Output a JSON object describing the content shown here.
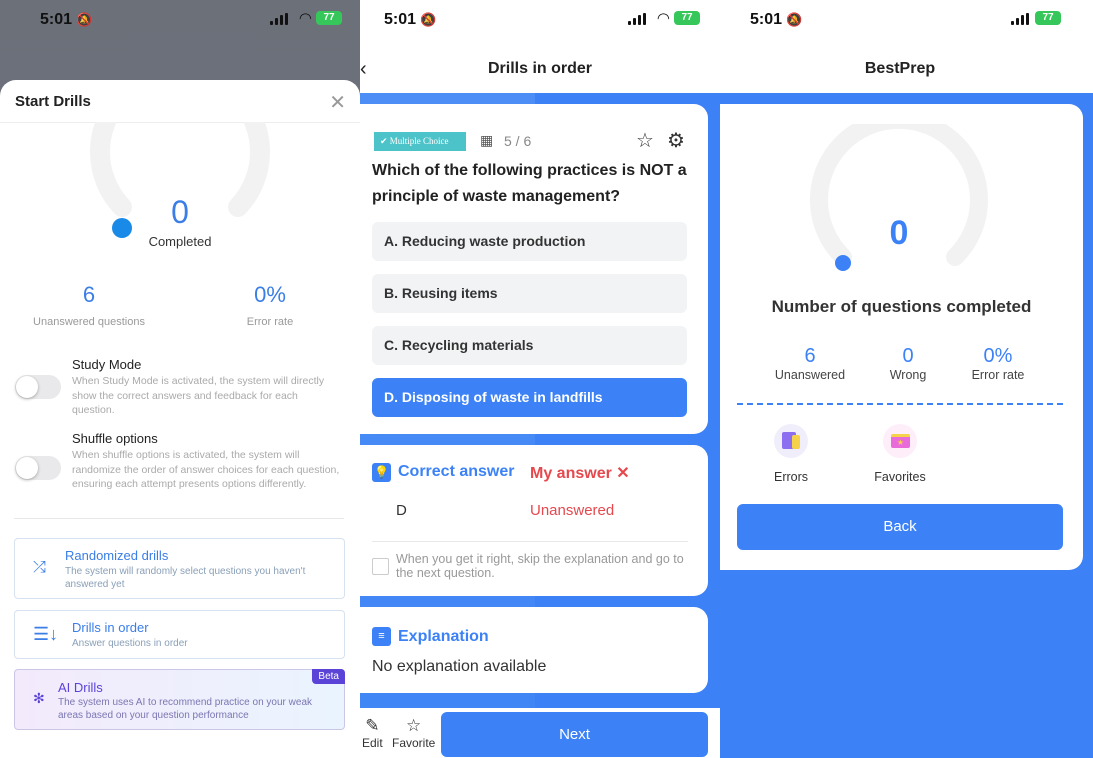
{
  "status_bar": {
    "time": "5:01",
    "battery": "77"
  },
  "start_drills": {
    "title": "Start Drills",
    "completed_value": "0",
    "completed_label": "Completed",
    "progress_fraction": 0,
    "unanswered_value": "6",
    "unanswered_label": "Unanswered questions",
    "error_rate_value": "0%",
    "error_rate_label": "Error rate",
    "study_mode": {
      "title": "Study Mode",
      "desc": "When Study Mode is activated, the system will directly show the correct answers and feedback for each question.",
      "on": false
    },
    "shuffle": {
      "title": "Shuffle options",
      "desc": "When shuffle options is activated, the system will randomize the order of answer choices for each question, ensuring each attempt presents options differently.",
      "on": false
    },
    "cards": [
      {
        "title": "Randomized drills",
        "desc": "The system will randomly select questions you haven't answered yet",
        "icon": "shuffle-icon"
      },
      {
        "title": "Drills in order",
        "desc": "Answer questions in order",
        "icon": "list-order-icon"
      },
      {
        "title": "AI Drills",
        "desc": "The system uses AI to recommend practice on your weak areas based on your question performance",
        "icon": "ai-atom-icon",
        "badge": "Beta"
      }
    ]
  },
  "drill": {
    "nav_title": "Drills in order",
    "tag": "Multiple Choice",
    "count": "5 / 6",
    "question": "Which of the following practices is NOT a principle of waste management?",
    "answers": [
      {
        "label": "A. Reducing waste production",
        "selected": false
      },
      {
        "label": "B. Reusing items",
        "selected": false
      },
      {
        "label": "C. Recycling materials",
        "selected": false
      },
      {
        "label": "D. Disposing of waste in landfills",
        "selected": true
      }
    ],
    "correct_answer_label": "Correct answer",
    "my_answer_label": "My answer ✕",
    "correct_answer_value": "D",
    "my_answer_value": "Unanswered",
    "skip_text": "When you get it right, skip the explanation and go to the next question.",
    "explanation_title": "Explanation",
    "explanation_body": "No explanation available",
    "edit_label": "Edit",
    "favorite_label": "Favorite",
    "next_label": "Next"
  },
  "result": {
    "nav_title": "BestPrep",
    "completed_value": "0",
    "progress_fraction": 0,
    "title": "Number of questions completed",
    "stats": [
      {
        "value": "6",
        "label": "Unanswered"
      },
      {
        "value": "0",
        "label": "Wrong"
      },
      {
        "value": "0%",
        "label": "Error rate"
      }
    ],
    "errors_label": "Errors",
    "favorites_label": "Favorites",
    "back_label": "Back"
  },
  "colors": {
    "accent": "#3c82f6",
    "error": "#e5484d",
    "ai": "#5b43d8",
    "tag": "#4cc3c9"
  }
}
